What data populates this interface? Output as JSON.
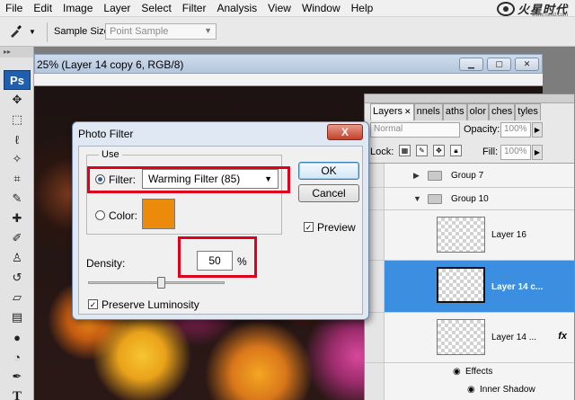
{
  "menu": [
    "File",
    "Edit",
    "Image",
    "Layer",
    "Select",
    "Filter",
    "Analysis",
    "View",
    "Window",
    "Help"
  ],
  "logo": {
    "text": "火星时代",
    "url": "www.hxsd.com"
  },
  "options": {
    "sample_size_label": "Sample Size:",
    "sample_size_value": "Point Sample"
  },
  "toolbox": {
    "badge": "Ps"
  },
  "document": {
    "title": "25% (Layer 14 copy 6, RGB/8)"
  },
  "layers_panel": {
    "tabs": [
      "Layers",
      "nnels",
      "aths",
      "olor",
      "ches",
      "tyles"
    ],
    "blend_mode": "Normal",
    "opacity_label": "Opacity:",
    "opacity_value": "100%",
    "lock_label": "Lock:",
    "fill_label": "Fill:",
    "fill_value": "100%",
    "layers": [
      {
        "name": "Group 7"
      },
      {
        "name": "Group 10"
      },
      {
        "name": "Layer 16"
      },
      {
        "name": "Layer 14 c..."
      },
      {
        "name": "Layer 14 ..."
      }
    ],
    "fx_label": "fx",
    "effects_label": "Effects",
    "inner_shadow_label": "Inner Shadow"
  },
  "dialog": {
    "title": "Photo Filter",
    "close": "X",
    "use_legend": "Use",
    "filter_label": "Filter:",
    "filter_value": "Warming Filter (85)",
    "color_label": "Color:",
    "color_value": "#ec8a0b",
    "density_label": "Density:",
    "density_value": "50",
    "density_unit": "%",
    "preserve_label": "Preserve Luminosity",
    "ok_label": "OK",
    "cancel_label": "Cancel",
    "preview_label": "Preview"
  },
  "colors": {
    "highlight": "#e0001b",
    "selection": "#3c8ee0",
    "swatch": "#ec8a0b"
  }
}
